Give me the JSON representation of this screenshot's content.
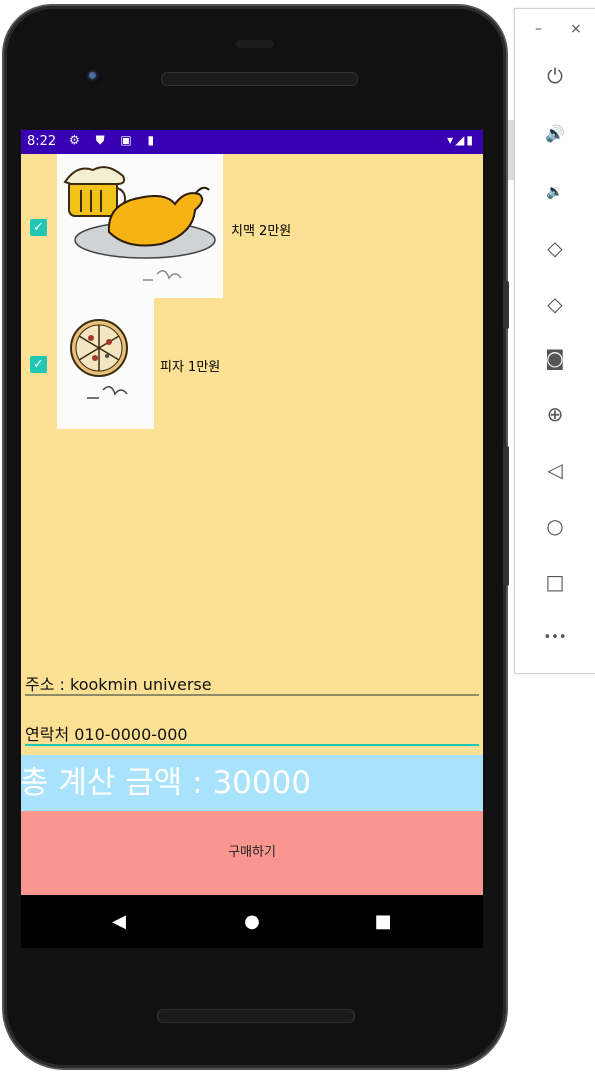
{
  "status_bar": {
    "time": "8:22",
    "left_icons": "⚙ ⛊ ▣ ▮",
    "right_icons": "▾◢▮"
  },
  "menu_items": [
    {
      "label": "치맥 2만원",
      "checked": true,
      "image": "chicken-beer-drawing"
    },
    {
      "label": "피자 1만원",
      "checked": true,
      "image": "pizza-drawing"
    }
  ],
  "address_field": {
    "value": "주소 : kookmin universe"
  },
  "phone_field": {
    "value": "연락처 010-0000-000"
  },
  "total": {
    "text": "총 계산 금액 : 30000"
  },
  "buy_button": {
    "label": "구매하기"
  },
  "nav": {
    "back_icon": "◀",
    "home_icon": "●",
    "recents_icon": "■"
  },
  "emulator_toolbar": {
    "minimize": "–",
    "close": "×",
    "buttons": [
      {
        "name": "power-icon",
        "glyph": "⏻"
      },
      {
        "name": "volume-up-icon",
        "glyph": "🔊"
      },
      {
        "name": "volume-down-icon",
        "glyph": "🔉"
      },
      {
        "name": "rotate-left-icon",
        "glyph": "◇"
      },
      {
        "name": "rotate-right-icon",
        "glyph": "◇"
      },
      {
        "name": "camera-icon",
        "glyph": "◙"
      },
      {
        "name": "zoom-icon",
        "glyph": "⊕"
      },
      {
        "name": "back-icon",
        "glyph": "◁"
      },
      {
        "name": "home-icon",
        "glyph": "○"
      },
      {
        "name": "overview-icon",
        "glyph": "□"
      },
      {
        "name": "more-icon",
        "glyph": "•••"
      }
    ]
  },
  "colors": {
    "status_bar": "#3700b3",
    "app_background": "#fce194",
    "checkbox": "#21c6b4",
    "total_background": "#a8e2fb",
    "buy_button": "#f8968f",
    "phone_underline": "#21c6b4"
  }
}
